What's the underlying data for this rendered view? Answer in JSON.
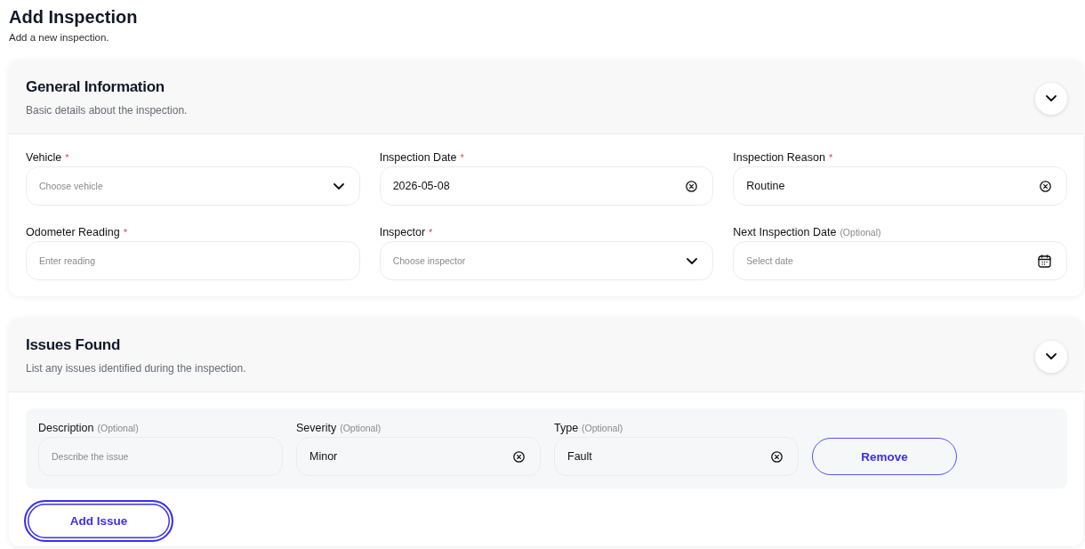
{
  "page": {
    "title": "Add Inspection",
    "subtitle": "Add a new inspection."
  },
  "sections": [
    {
      "kind": "fields",
      "title": "General Information",
      "description": "Basic details about the inspection.",
      "expanded": true,
      "fields": [
        {
          "label": "Vehicle",
          "required": true,
          "marker": "*",
          "kind": "select",
          "placeholder": "Choose vehicle"
        },
        {
          "label": "Inspection Date",
          "required": true,
          "marker": "*",
          "kind": "clearable",
          "value": "2026-05-08"
        },
        {
          "label": "Inspection Reason",
          "required": true,
          "marker": "*",
          "kind": "clearable",
          "value": "Routine"
        },
        {
          "label": "Odometer Reading",
          "required": true,
          "marker": "*",
          "kind": "text",
          "placeholder": "Enter reading"
        },
        {
          "label": "Inspector",
          "required": true,
          "marker": "*",
          "kind": "select",
          "placeholder": "Choose inspector"
        },
        {
          "label": "Next Inspection Date",
          "required": false,
          "marker": "(Optional)",
          "kind": "date",
          "placeholder": "Select date"
        }
      ]
    },
    {
      "kind": "issues",
      "title": "Issues Found",
      "description": "List any issues identified during the inspection.",
      "expanded": true,
      "issues": [
        {
          "fields": [
            {
              "label": "Description",
              "required": false,
              "marker": "(Optional)",
              "kind": "text",
              "placeholder": "Describe the issue"
            },
            {
              "label": "Severity",
              "required": false,
              "marker": "(Optional)",
              "kind": "clearable",
              "value": "Minor"
            },
            {
              "label": "Type",
              "required": false,
              "marker": "(Optional)",
              "kind": "clearable",
              "value": "Fault"
            }
          ],
          "remove_button": {
            "label": "Remove",
            "focused": false
          }
        }
      ],
      "add_button": {
        "label": "Add Issue",
        "focused": true
      }
    }
  ]
}
